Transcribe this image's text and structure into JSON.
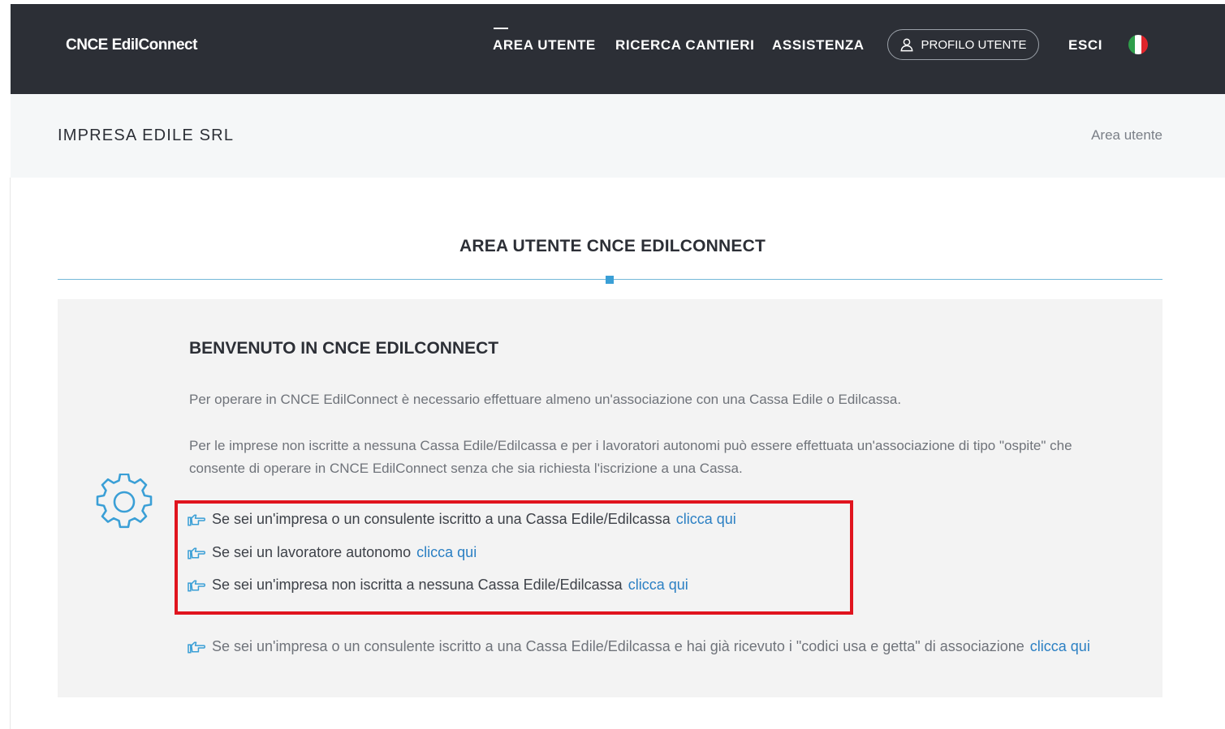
{
  "navbar": {
    "brand": "CNCE EdilConnect",
    "items": [
      {
        "label": "AREA UTENTE"
      },
      {
        "label": "RICERCA CANTIERI"
      },
      {
        "label": "ASSISTENZA"
      }
    ],
    "profile_label": "PROFILO UTENTE",
    "logout_label": "ESCI",
    "language_flag_colors": [
      "#2e9e4a",
      "#ffffff",
      "#e0252b"
    ]
  },
  "header": {
    "company": "IMPRESA EDILE SRL",
    "breadcrumb": "Area utente"
  },
  "section": {
    "title": "AREA UTENTE CNCE EDILCONNECT"
  },
  "welcome": {
    "title": "BENVENUTO IN CNCE EDILCONNECT",
    "paragraph1": "Per operare in CNCE EdilConnect è necessario effettuare almeno un'associazione con una Cassa Edile o Edilcassa.",
    "paragraph2": "Per le imprese non iscritte a nessuna Cassa Edile/Edilcassa e per i lavoratori autonomi può essere effettuata un'associazione di tipo \"ospite\" che consente di operare in CNCE EdilConnect senza che sia richiesta l'iscrizione a una Cassa.",
    "choices": [
      {
        "text": "Se sei un'impresa o un consulente iscritto a una Cassa Edile/Edilcassa",
        "link": "clicca qui"
      },
      {
        "text": "Se sei un lavoratore autonomo",
        "link": "clicca qui"
      },
      {
        "text": "Se sei un'impresa non iscritta a nessuna Cassa Edile/Edilcassa",
        "link": "clicca qui"
      },
      {
        "text": "Se sei un'impresa o un consulente iscritto a una Cassa Edile/Edilcassa e hai già ricevuto i \"codici usa e getta\" di associazione",
        "link": "clicca qui"
      }
    ]
  },
  "colors": {
    "navbar_bg": "#2c2f36",
    "accent": "#3a9fd6",
    "link": "#2a7fc3",
    "highlight_border": "#e0141e"
  },
  "icons": {
    "gear": "gear-icon",
    "pointer": "pointing-hand-icon",
    "user": "user-icon"
  }
}
